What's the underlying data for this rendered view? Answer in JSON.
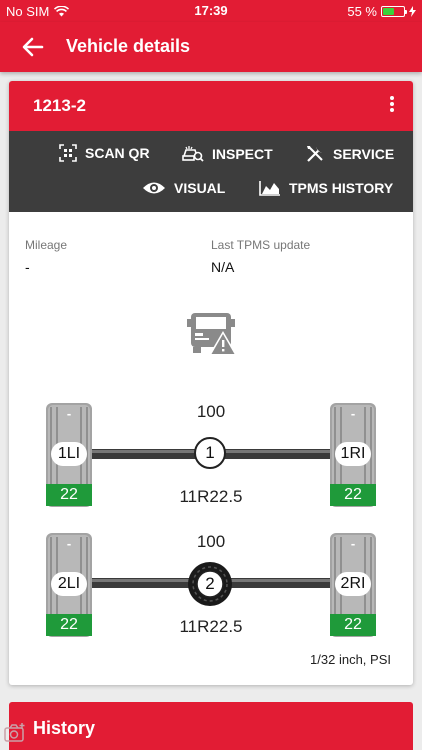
{
  "status": {
    "carrier": "No SIM",
    "time": "17:39",
    "battery": "55 %",
    "battery_level": 0.55
  },
  "app_bar": {
    "title": "Vehicle details"
  },
  "vehicle": {
    "id": "1213-2",
    "actions": [
      {
        "label": "SCAN QR",
        "icon": "qr-scan-icon"
      },
      {
        "label": "INSPECT",
        "icon": "inspect-icon"
      },
      {
        "label": "SERVICE",
        "icon": "tools-icon"
      },
      {
        "label": "VISUAL",
        "icon": "eye-icon"
      },
      {
        "label": "TPMS HISTORY",
        "icon": "chart-icon"
      }
    ],
    "mileage_label": "Mileage",
    "mileage_value": "-",
    "tpms_label": "Last TPMS update",
    "tpms_value": "N/A",
    "axles": [
      {
        "number": "1",
        "top_value": "100",
        "tire_size": "11R22.5",
        "left": {
          "position": "1LI",
          "tread": "-",
          "pressure": "22"
        },
        "right": {
          "position": "1RI",
          "tread": "-",
          "pressure": "22"
        }
      },
      {
        "number": "2",
        "top_value": "100",
        "tire_size": "11R22.5",
        "left": {
          "position": "2LI",
          "tread": "-",
          "pressure": "22"
        },
        "right": {
          "position": "2RI",
          "tread": "-",
          "pressure": "22"
        }
      }
    ],
    "units": "1/32 inch, PSI"
  },
  "history": {
    "title": "History"
  },
  "colors": {
    "brand_red": "#e21c34",
    "action_bar": "#3d3d3d",
    "pressure_green": "#1f9a3a"
  }
}
